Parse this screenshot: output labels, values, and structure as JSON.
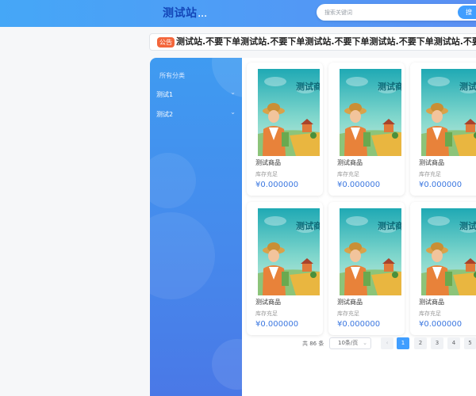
{
  "header": {
    "logo": "测试站",
    "logo_suffix": "...",
    "search_placeholder": "搜索关键词",
    "search_button": "搜"
  },
  "notice": {
    "badge": "公告",
    "text": "测试站.不要下单测试站.不要下单测试站.不要下单测试站.不要下单测试站.不要下单测试站.不要下"
  },
  "sidebar": {
    "heading": "所有分类",
    "items": [
      {
        "label": "测试1",
        "icon": "chevron-down-icon"
      },
      {
        "label": "测试2",
        "icon": "chevron-down-icon"
      }
    ]
  },
  "products": [
    {
      "name": "测试商品",
      "stock": "库存充足",
      "price": "¥0.000000"
    },
    {
      "name": "测试商品",
      "stock": "库存充足",
      "price": "¥0.000000"
    },
    {
      "name": "测试商品",
      "stock": "库存充足",
      "price": "¥0.000000"
    },
    {
      "name": "测试商品",
      "stock": "库存充足",
      "price": "¥0.000000"
    },
    {
      "name": "测试商品",
      "stock": "库存充足",
      "price": "¥0.000000"
    },
    {
      "name": "测试商品",
      "stock": "库存充足",
      "price": "¥0.000000"
    }
  ],
  "product_image_caption": "测试商品",
  "pagination": {
    "total": "共 86 条",
    "page_size": "10条/页",
    "prev": "‹",
    "pages": [
      "1",
      "2",
      "3",
      "4",
      "5"
    ],
    "active_page": "1"
  },
  "colors": {
    "header_gradient_start": "#45a7f7",
    "header_gradient_end": "#5a8ff3",
    "accent": "#409eff",
    "price": "#3b77e0",
    "notice_badge": "#f3663b",
    "logo": "#1346b8"
  }
}
